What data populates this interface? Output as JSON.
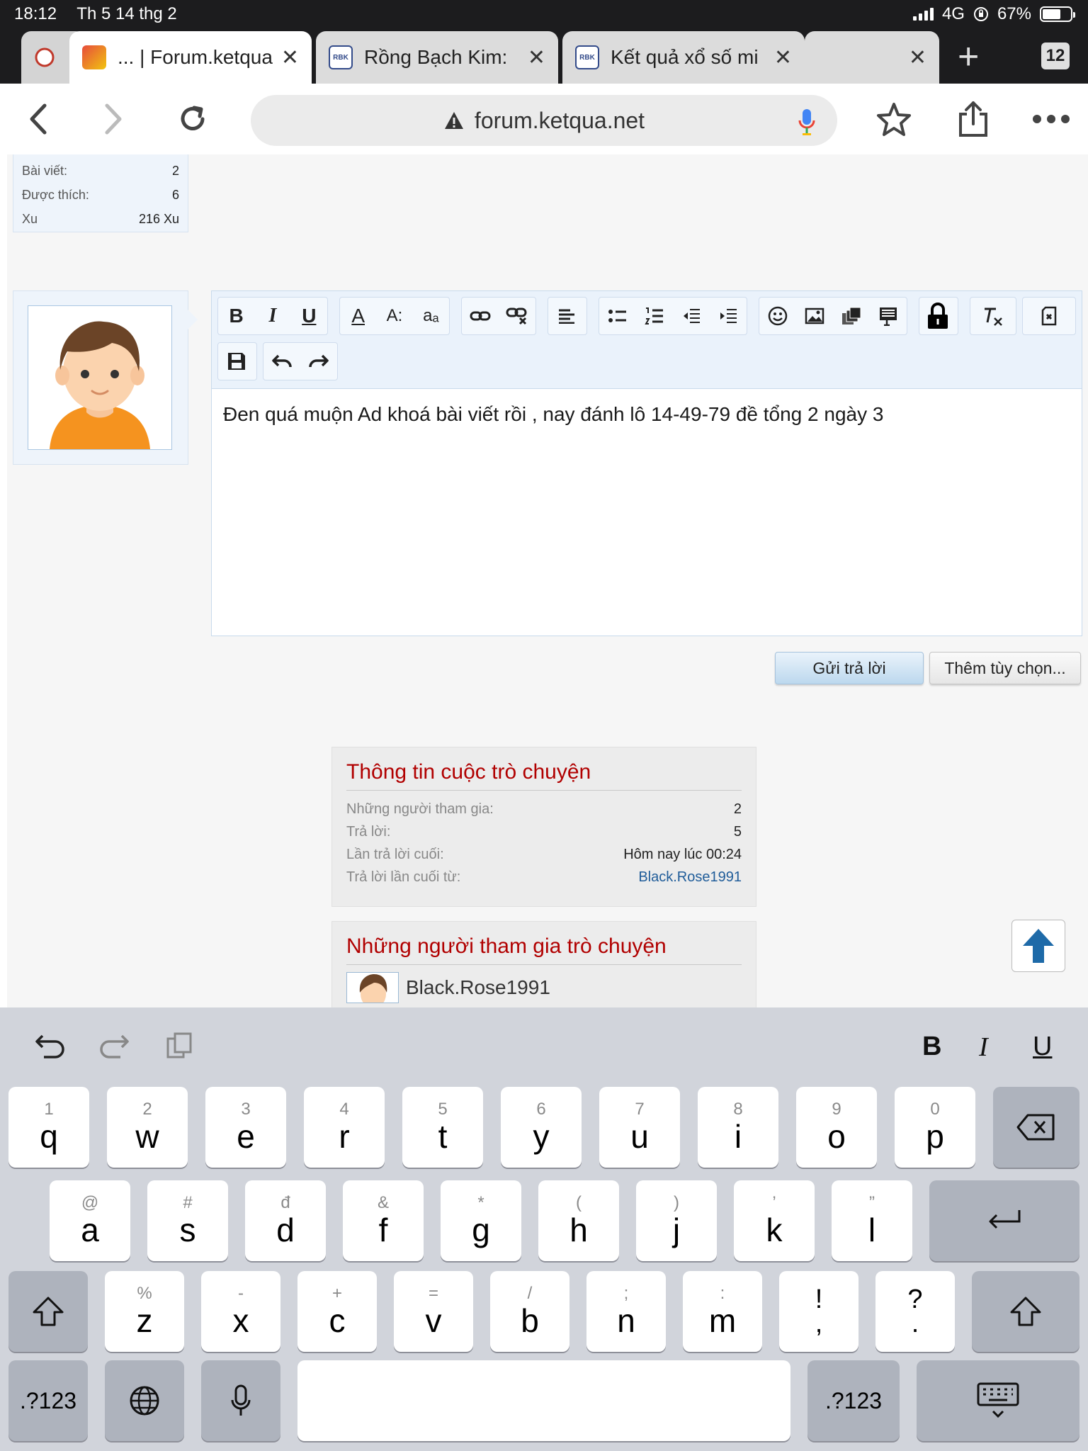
{
  "status": {
    "time": "18:12",
    "date": "Th 5 14 thg 2",
    "network": "4G",
    "battery": "67%"
  },
  "tabs": [
    {
      "title": "... | Forum.ketqua",
      "active": true
    },
    {
      "title": "Rồng Bạch Kim:",
      "active": false
    },
    {
      "title": "Kết quả xổ số mi",
      "active": false
    }
  ],
  "tab_count": "12",
  "favicon_text": "RBK",
  "toolbar": {
    "url": "forum.ketqua.net"
  },
  "user_stats": [
    {
      "label": "Bài viết:",
      "value": "2"
    },
    {
      "label": "Được thích:",
      "value": "6"
    },
    {
      "label": "Xu",
      "value": "216 Xu"
    }
  ],
  "editor": {
    "text": "Đen quá muộn Ad khoá bài viết rồi , nay đánh lô 14-49-79 đề tổng 2 ngày 3",
    "tools": {
      "bold": "B",
      "italic": "I",
      "underline": "U",
      "font_color": "A",
      "font_size": "A:",
      "font_family": "aₐ"
    }
  },
  "buttons": {
    "send": "Gửi trả lời",
    "more": "Thêm tùy chọn..."
  },
  "thread_info": {
    "title": "Thông tin cuộc trò chuyện",
    "rows": [
      {
        "label": "Những người tham gia:",
        "value": "2"
      },
      {
        "label": "Trả lời:",
        "value": "5"
      },
      {
        "label": "Lần trả lời cuối:",
        "value": "Hôm nay lúc 00:24"
      },
      {
        "label": "Trả lời lần cuối từ:",
        "value": "Black.Rose1991"
      }
    ]
  },
  "participants": {
    "title": "Những người tham gia trò chuyện",
    "items": [
      "Black.Rose1991"
    ]
  },
  "keyboard": {
    "format": {
      "bold": "B",
      "italic": "I",
      "underline": "U"
    },
    "row1": [
      {
        "hint": "1",
        "key": "q"
      },
      {
        "hint": "2",
        "key": "w"
      },
      {
        "hint": "3",
        "key": "e"
      },
      {
        "hint": "4",
        "key": "r"
      },
      {
        "hint": "5",
        "key": "t"
      },
      {
        "hint": "6",
        "key": "y"
      },
      {
        "hint": "7",
        "key": "u"
      },
      {
        "hint": "8",
        "key": "i"
      },
      {
        "hint": "9",
        "key": "o"
      },
      {
        "hint": "0",
        "key": "p"
      }
    ],
    "row2": [
      {
        "hint": "@",
        "key": "a"
      },
      {
        "hint": "#",
        "key": "s"
      },
      {
        "hint": "đ",
        "key": "d"
      },
      {
        "hint": "&",
        "key": "f"
      },
      {
        "hint": "*",
        "key": "g"
      },
      {
        "hint": "(",
        "key": "h"
      },
      {
        "hint": ")",
        "key": "j"
      },
      {
        "hint": "’",
        "key": "k"
      },
      {
        "hint": "”",
        "key": "l"
      }
    ],
    "row3": [
      {
        "hint": "%",
        "key": "z"
      },
      {
        "hint": "-",
        "key": "x"
      },
      {
        "hint": "+",
        "key": "c"
      },
      {
        "hint": "=",
        "key": "v"
      },
      {
        "hint": "/",
        "key": "b"
      },
      {
        "hint": ";",
        "key": "n"
      },
      {
        "hint": ":",
        "key": "m"
      },
      {
        "hint": "!",
        "key": ","
      },
      {
        "hint": "?",
        "key": "."
      }
    ],
    "numbers_label": ".?123"
  }
}
